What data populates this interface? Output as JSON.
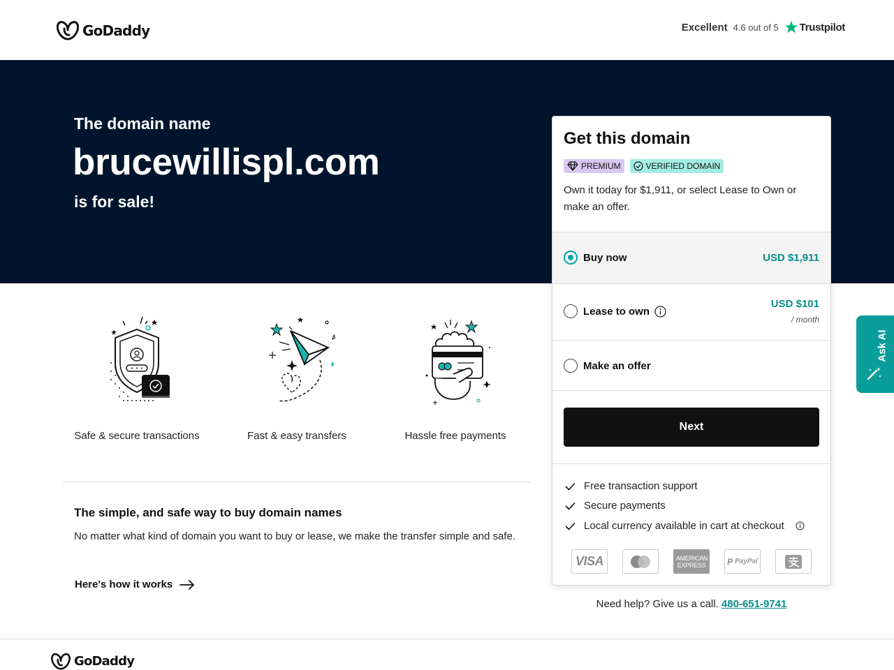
{
  "header": {
    "brand": "GoDaddy",
    "trustpilot": {
      "label": "Excellent",
      "rating": "4.6 out of 5",
      "brand": "Trustpilot"
    }
  },
  "hero": {
    "pre": "The domain name",
    "domain": "brucewillispl.com",
    "post": "is for sale!"
  },
  "features": [
    {
      "label": "Safe & secure transactions"
    },
    {
      "label": "Fast & easy transfers"
    },
    {
      "label": "Hassle free payments"
    }
  ],
  "info": {
    "title": "The simple, and safe way to buy domain names",
    "body": "No matter what kind of domain you want to buy or lease, we make the transfer simple and safe.",
    "link": "Here's how it works"
  },
  "card": {
    "title": "Get this domain",
    "badges": {
      "premium": "PREMIUM",
      "verified": "VERIFIED DOMAIN"
    },
    "description": "Own it today for $1,911, or select Lease to Own or make an offer.",
    "options": [
      {
        "label": "Buy now",
        "price": "USD $1,911",
        "selected": true
      },
      {
        "label": "Lease to own",
        "price": "USD $101",
        "sub": "/ month",
        "selected": false
      },
      {
        "label": "Make an offer",
        "selected": false
      }
    ],
    "next_label": "Next",
    "benefits": [
      "Free transaction support",
      "Secure payments",
      "Local currency available in cart at checkout"
    ],
    "payment_methods": [
      "VISA",
      "Mastercard",
      "AMERICAN EXPRESS",
      "PayPal",
      "Alipay"
    ]
  },
  "help": {
    "text": "Need help? Give us a call.",
    "phone": "480-651-9741"
  },
  "ask_ai": {
    "label": "Ask AI"
  },
  "footer": {
    "brand": "GoDaddy"
  },
  "colors": {
    "hero_bg": "#00152d",
    "accent": "#0a8e8a",
    "teal": "#00a4a6",
    "premium_badge": "#d8c7f0",
    "verified_badge": "#a3ece3"
  }
}
